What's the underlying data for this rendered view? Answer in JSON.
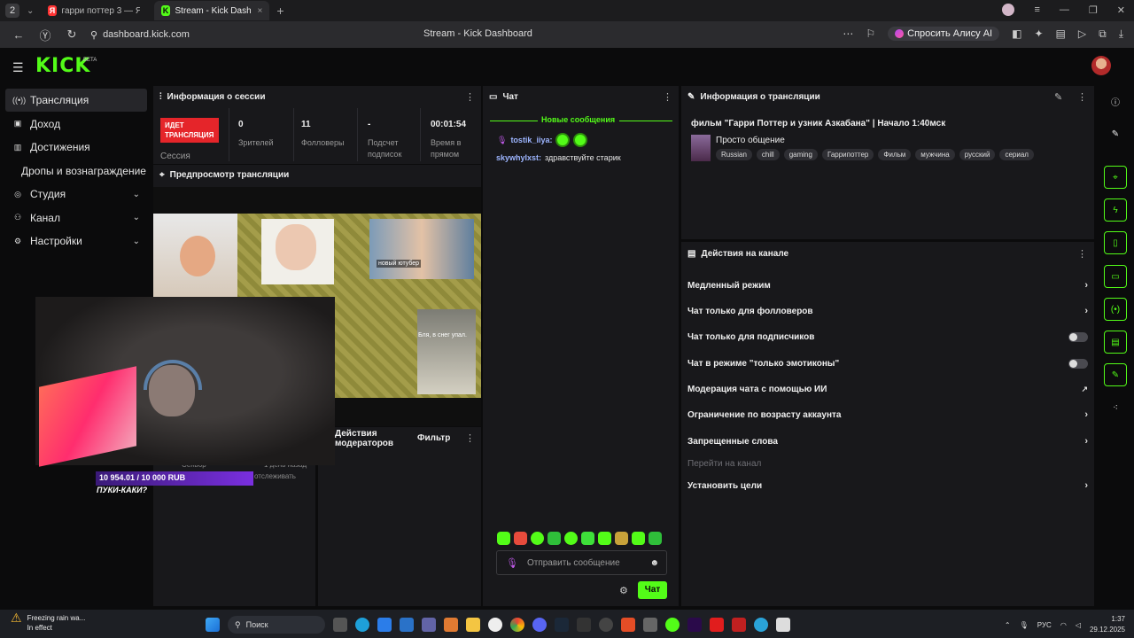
{
  "browser": {
    "tab_count": "2",
    "tabs": [
      {
        "label": "гарри поттер 3 — Яндекс",
        "favicon": "Я",
        "favicon_color": "#ff3333"
      },
      {
        "label": "Stream - Kick Dashboard",
        "favicon": "K",
        "favicon_color": "#53fc18"
      }
    ],
    "url": "dashboard.kick.com",
    "page_title": "Stream - Kick Dashboard",
    "alice_label": "Спросить Алису AI"
  },
  "app": {
    "logo": "KICK",
    "beta": "BETA",
    "accent": "#53fc18",
    "live_color": "#e5252a"
  },
  "sidebar": {
    "items": [
      {
        "label": "Трансляция",
        "icon": "broadcast-icon"
      },
      {
        "label": "Доход",
        "icon": "wallet-icon"
      },
      {
        "label": "Достижения",
        "icon": "trophy-icon"
      },
      {
        "label": "Дропы и вознаграждение",
        "icon": ""
      },
      {
        "label": "Студия",
        "icon": "studio-icon"
      },
      {
        "label": "Канал",
        "icon": "users-icon"
      },
      {
        "label": "Настройки",
        "icon": "gear-icon"
      }
    ]
  },
  "session": {
    "title": "Информация о сессии",
    "live_badge": "ИДЕТ ТРАНСЛЯЦИЯ",
    "session_label": "Сессия",
    "viewers_value": "0",
    "viewers_label": "Зрителей",
    "followers_value": "11",
    "followers_label": "Фолловеры",
    "subs_value": "-",
    "subs_label": "Подсчет подписок",
    "time_value": "00:01:54",
    "time_label": "Время в прямом"
  },
  "preview": {
    "title": "Предпросмотр трансляции",
    "meme_caption_1": "новый ютубер",
    "meme_caption_2": "Бля, в снег упал.",
    "goal_text": "10 954.01 / 10 000 RUB",
    "goal_sub": "ПУКИ-КАКИ?",
    "ghost_1": "Сеньор",
    "ghost_2": "1 день назад",
    "ghost_3": "отслеживать"
  },
  "mod_panel": {
    "actions_label": "Действия модераторов",
    "filter_label": "Фильтр"
  },
  "chat": {
    "title": "Чат",
    "new_messages": "Новые сообщения",
    "messages": [
      {
        "user": "tostik_iiya:",
        "user_color": "#9db5ff",
        "text": ""
      },
      {
        "user": "skywhylxst:",
        "user_color": "#9db5ff",
        "text": "здравствуйте старик"
      }
    ],
    "input_placeholder": "Отправить сообщение",
    "send_label": "Чат"
  },
  "stream_info": {
    "title": "Информация о трансляции",
    "stream_title": "фильм \"Гарри Поттер и узник Азкабана\" | Начало 1:40мск",
    "category": "Просто общение",
    "tags": [
      "Russian",
      "chill",
      "gaming",
      "Гаррипоттер",
      "Фильм",
      "мужчина",
      "русский",
      "сериал"
    ]
  },
  "channel_actions": {
    "title": "Действия на канале",
    "rows": [
      {
        "label": "Медленный режим",
        "control": "arrow"
      },
      {
        "label": "Чат только для фолловеров",
        "control": "arrow"
      },
      {
        "label": "Чат только для подписчиков",
        "control": "toggle"
      },
      {
        "label": "Чат в режиме \"только эмотиконы\"",
        "control": "toggle"
      },
      {
        "label": "Модерация чата с помощью ИИ",
        "control": "external"
      },
      {
        "label": "Ограничение по возрасту аккаунта",
        "control": "arrow"
      },
      {
        "label": "Запрещенные слова",
        "control": "arrow"
      },
      {
        "label": "Перейти на канал",
        "control": "none"
      },
      {
        "label": "Установить цели",
        "control": "arrow"
      }
    ]
  },
  "taskbar": {
    "weather_title": "Freezing rain wa...",
    "weather_sub": "In effect",
    "search": "Поиск",
    "lang": "РУС",
    "time": "1:37",
    "date": "29.12.2025"
  }
}
